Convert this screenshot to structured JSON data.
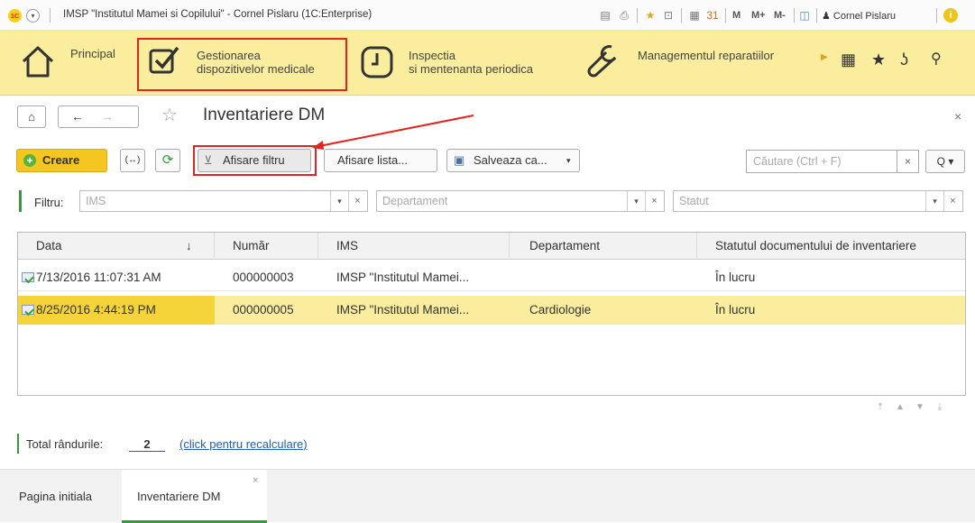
{
  "window": {
    "title": "IMSP \"Institutul Mamei si Copilului\" - Cornel Pislaru   (1C:Enterprise)",
    "app_badge": "1C",
    "memory_buttons": [
      "M",
      "M+",
      "M-"
    ],
    "user": "Cornel Pislaru"
  },
  "sections": [
    {
      "label_line1": "Principal",
      "label_line2": ""
    },
    {
      "label_line1": "Gestionarea",
      "label_line2": "dispozitivelor medicale"
    },
    {
      "label_line1": "Inspectia",
      "label_line2": "si mentenanta periodica"
    },
    {
      "label_line1": "Managementul reparatiilor",
      "label_line2": ""
    }
  ],
  "form": {
    "title": "Inventariere DM",
    "close": "×"
  },
  "toolbar": {
    "create": "Creare",
    "output": "(↔)",
    "refresh": "⟳",
    "show_filter": "Afisare filtru",
    "show_list": "Afisare lista...",
    "save_as": "Salveaza ca...",
    "search_placeholder": "Căutare (Ctrl + F)",
    "search_clear": "×",
    "search_btn": "Q"
  },
  "filter": {
    "label": "Filtru:",
    "ims_placeholder": "IMS",
    "dept_placeholder": "Departament",
    "status_placeholder": "Statut"
  },
  "table": {
    "columns": [
      "Data",
      "Număr",
      "IMS",
      "Departament",
      "Statutul documentului de inventariere"
    ],
    "sort_indicator": "↓",
    "rows": [
      {
        "date": "7/13/2016 11:07:31 AM",
        "number": "000000003",
        "ims": "IMSP \"Institutul  Mamei...",
        "dept": "",
        "status": "În lucru",
        "selected": false
      },
      {
        "date": "8/25/2016 4:44:19 PM",
        "number": "000000005",
        "ims": "IMSP \"Institutul  Mamei...",
        "dept": "Cardiologie",
        "status": "În lucru",
        "selected": true
      }
    ]
  },
  "footer": {
    "total_label": "Total rândurile:",
    "total_value": "2",
    "recalc": "(click pentru recalculare)"
  },
  "bottom_tabs": [
    {
      "label": "Pagina initiala",
      "active": false
    },
    {
      "label": "Inventariere DM",
      "active": true,
      "close": "×"
    }
  ],
  "colors": {
    "sections_bg": "#fbed9e",
    "accent_red": "#e3231f",
    "selected_row": "#fbed9e",
    "create_btn": "#f5c520",
    "link": "#1f5fb8"
  }
}
